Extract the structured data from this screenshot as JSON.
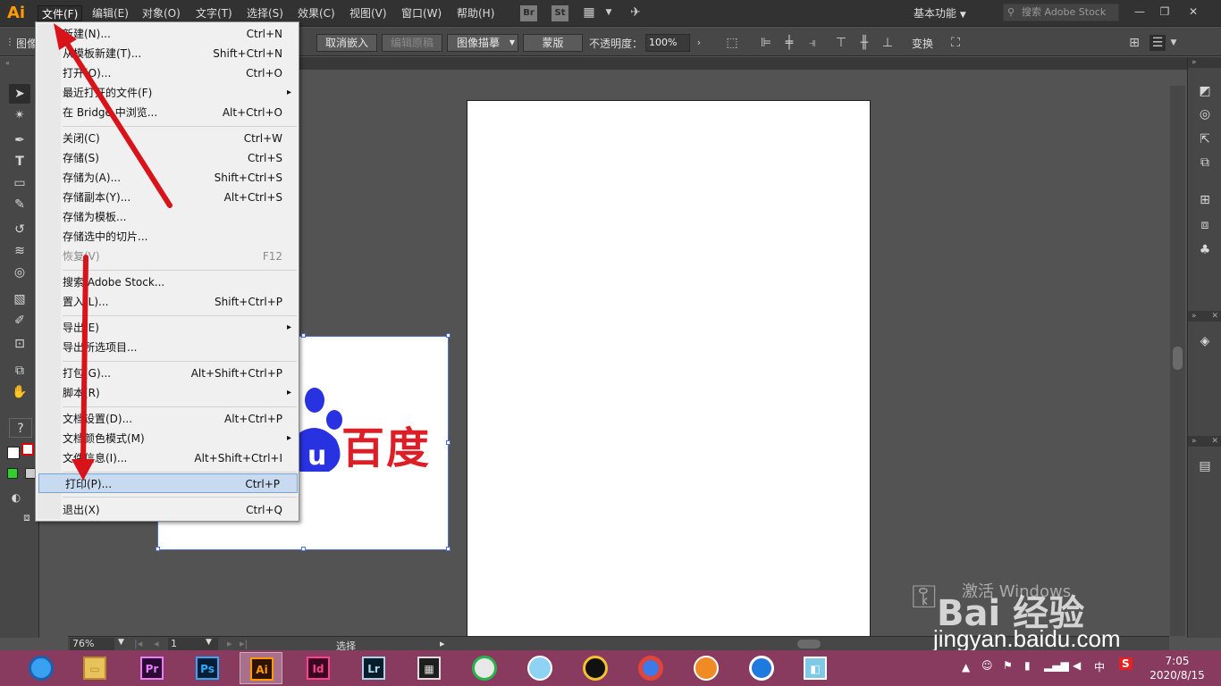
{
  "app": {
    "logo": "Ai"
  },
  "menubar": {
    "items": [
      "文件(F)",
      "编辑(E)",
      "对象(O)",
      "文字(T)",
      "选择(S)",
      "效果(C)",
      "视图(V)",
      "窗口(W)",
      "帮助(H)"
    ],
    "bridge": "Br",
    "stock": "St",
    "workspace": "基本功能",
    "search_placeholder": "搜索 Adobe Stock"
  },
  "controlbar": {
    "left_label": "图像",
    "unembed": "取消嵌入",
    "edit_original": "编辑原稿",
    "image_trace": "图像描摹",
    "mask": "蒙版",
    "opacity_label": "不透明度：",
    "opacity_value": "100%",
    "transform": "变换"
  },
  "file_menu": {
    "new": {
      "label": "新建(N)...",
      "shortcut": "Ctrl+N"
    },
    "from_template": {
      "label": "从模板新建(T)...",
      "shortcut": "Shift+Ctrl+N"
    },
    "open": {
      "label": "打开(O)...",
      "shortcut": "Ctrl+O"
    },
    "recent": {
      "label": "最近打开的文件(F)"
    },
    "bridge": {
      "label": "在 Bridge 中浏览...",
      "shortcut": "Alt+Ctrl+O"
    },
    "close": {
      "label": "关闭(C)",
      "shortcut": "Ctrl+W"
    },
    "save": {
      "label": "存储(S)",
      "shortcut": "Ctrl+S"
    },
    "save_as": {
      "label": "存储为(A)...",
      "shortcut": "Shift+Ctrl+S"
    },
    "save_copy": {
      "label": "存储副本(Y)...",
      "shortcut": "Alt+Ctrl+S"
    },
    "save_template": {
      "label": "存储为模板..."
    },
    "save_slices": {
      "label": "存储选中的切片..."
    },
    "revert": {
      "label": "恢复(V)",
      "shortcut": "F12"
    },
    "search_stock": {
      "label": "搜索 Adobe Stock..."
    },
    "place": {
      "label": "置入(L)...",
      "shortcut": "Shift+Ctrl+P"
    },
    "export": {
      "label": "导出(E)"
    },
    "export_selection": {
      "label": "导出所选项目..."
    },
    "package": {
      "label": "打包(G)...",
      "shortcut": "Alt+Shift+Ctrl+P"
    },
    "scripts": {
      "label": "脚本(R)"
    },
    "doc_setup": {
      "label": "文档设置(D)...",
      "shortcut": "Alt+Ctrl+P"
    },
    "color_mode": {
      "label": "文档颜色模式(M)"
    },
    "file_info": {
      "label": "文件信息(I)...",
      "shortcut": "Alt+Shift+Ctrl+I"
    },
    "print": {
      "label": "打印(P)...",
      "shortcut": "Ctrl+P"
    },
    "exit": {
      "label": "退出(X)",
      "shortcut": "Ctrl+Q"
    }
  },
  "artwork": {
    "baidu_text": "百度",
    "paw_letter": "u"
  },
  "statusbar": {
    "zoom": "76%",
    "page": "1",
    "status": "选择"
  },
  "taskbar": {
    "apps": [
      "Pr",
      "Ps",
      "Ai",
      "Id",
      "Lr"
    ],
    "time": "7:05",
    "date": "2020/8/15",
    "ime": "中"
  },
  "watermark": {
    "windows_text": "激活 Windows",
    "logo_text": "Bai 经验",
    "url": "jingyan.baidu.com"
  },
  "colors": {
    "highlight": "#c7daf0",
    "annotation_arrow": "#d8131a",
    "baidu_red": "#de1e27",
    "baidu_blue": "#2932e1",
    "taskbar": "#893a5f"
  }
}
